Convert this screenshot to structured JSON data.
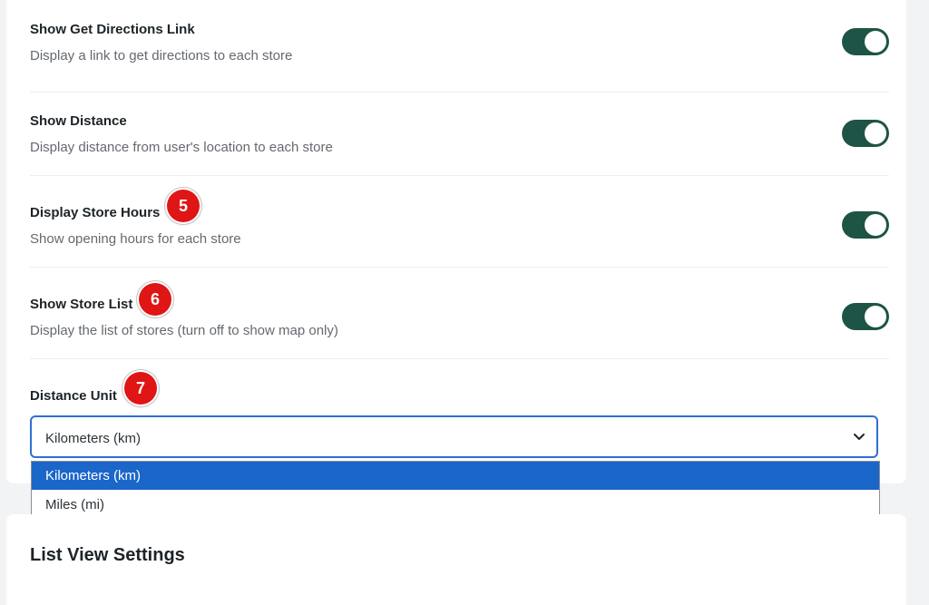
{
  "settings": [
    {
      "title": "Show Get Directions Link",
      "description": "Display a link to get directions to each store",
      "enabled": true
    },
    {
      "title": "Show Distance",
      "description": "Display distance from user's location to each store",
      "enabled": true
    },
    {
      "title": "Display Store Hours",
      "description": "Show opening hours for each store",
      "enabled": true
    },
    {
      "title": "Show Store List",
      "description": "Display the list of stores (turn off to show map only)",
      "enabled": true
    }
  ],
  "distance_unit": {
    "label": "Distance Unit",
    "selected": "Kilometers (km)",
    "options": [
      "Kilometers (km)",
      "Miles (mi)"
    ]
  },
  "badges": [
    "5",
    "6",
    "7"
  ],
  "list_view": {
    "title": "List View Settings"
  },
  "colors": {
    "toggle_on": "#1d5445",
    "badge": "#e01515",
    "option_highlight": "#1b66c9",
    "select_border": "#2f6fd1"
  }
}
